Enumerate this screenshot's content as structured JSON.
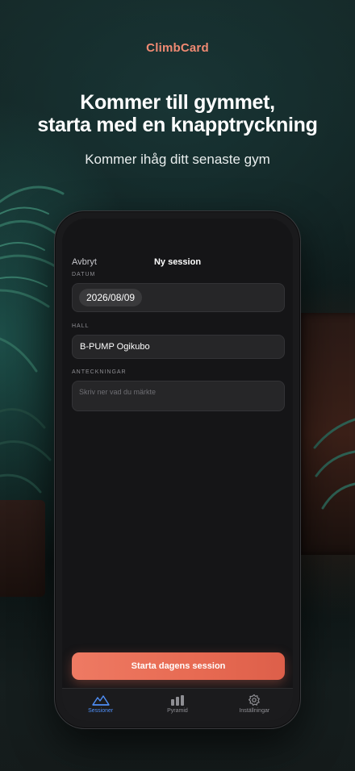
{
  "brand": "ClimbCard",
  "headline": {
    "line1": "Kommer till gymmet,",
    "line2": "starta med en knapptryckning"
  },
  "subheadline": "Kommer ihåg ditt senaste gym",
  "screen": {
    "nav": {
      "cancel_label": "Avbryt",
      "title": "Ny session"
    },
    "date": {
      "label": "DATUM",
      "value": "2026/08/09"
    },
    "hall": {
      "label": "HALL",
      "value": "B-PUMP Ogikubo"
    },
    "notes": {
      "label": "ANTECKNINGAR",
      "placeholder": "Skriv ner vad du märkte",
      "value": ""
    },
    "start_button": "Starta dagens session",
    "tabs": [
      {
        "label": "Sessioner",
        "icon": "mountain-icon",
        "active": true
      },
      {
        "label": "Pyramid",
        "icon": "bar-chart-icon",
        "active": false
      },
      {
        "label": "Inställningar",
        "icon": "gear-icon",
        "active": false
      }
    ]
  },
  "colors": {
    "accent": "#f08a73",
    "button": "#e76a52",
    "active_tab": "#4f8ff7"
  }
}
